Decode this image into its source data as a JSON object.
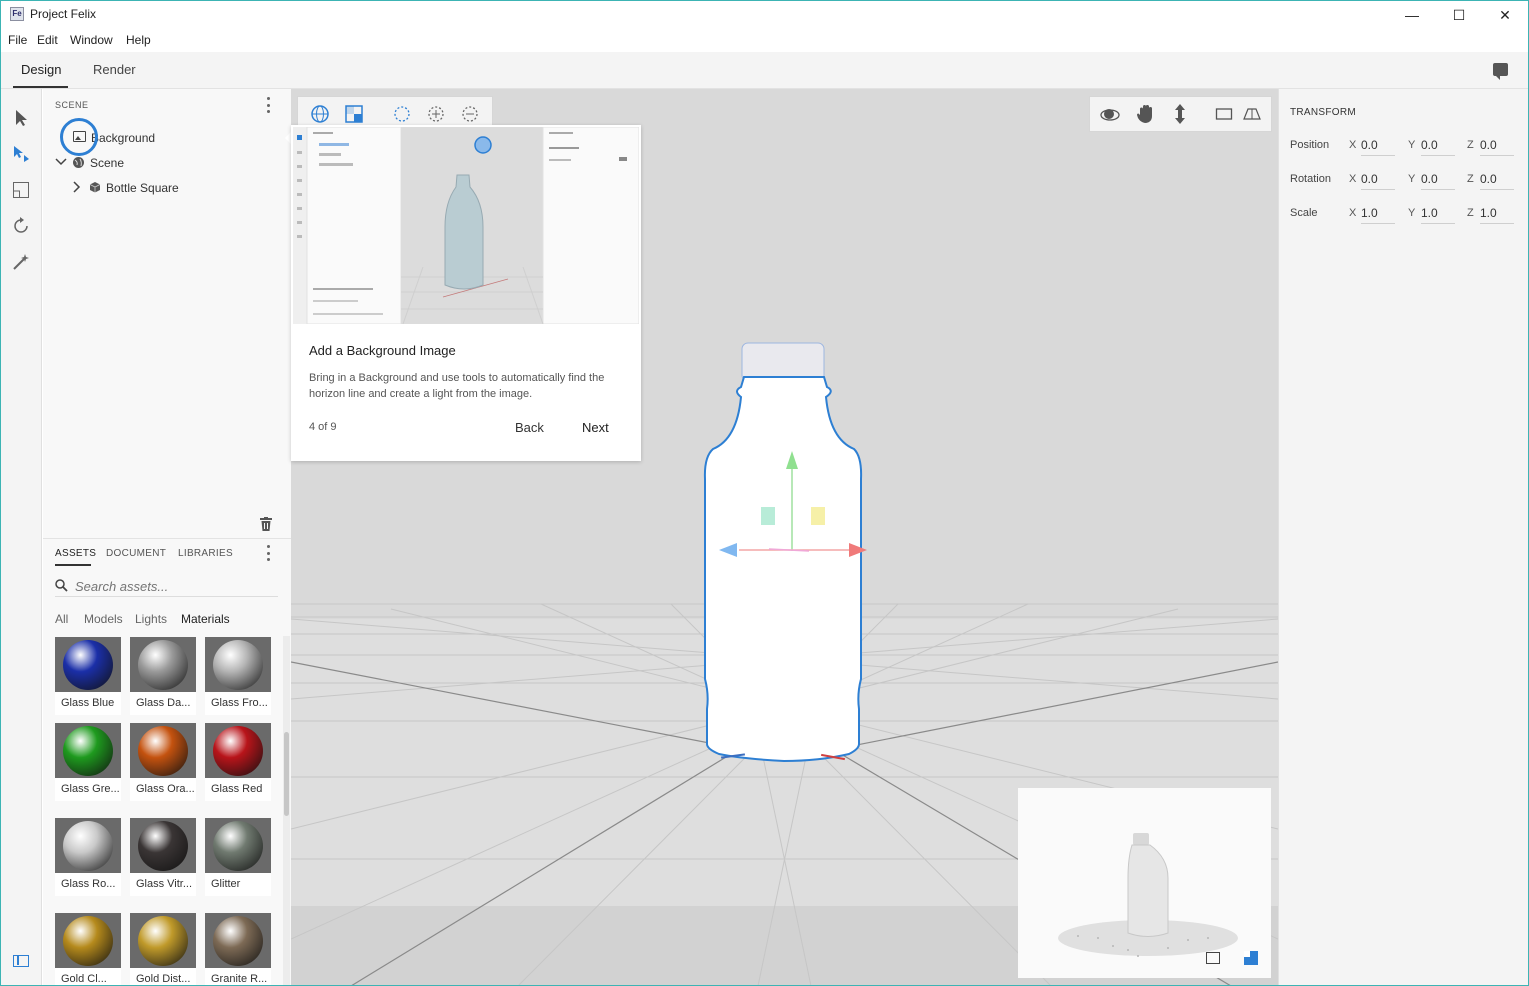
{
  "window": {
    "title": "Project Felix",
    "app_icon_text": "Fe",
    "minimize": "—",
    "maximize": "☐",
    "close": "✕"
  },
  "menu": [
    "File",
    "Edit",
    "Window",
    "Help"
  ],
  "modes": {
    "design": "Design",
    "render": "Render",
    "active": "Design"
  },
  "scene": {
    "header": "SCENE",
    "items": [
      {
        "label": "Background",
        "icon": "image-icon",
        "indent": 0
      },
      {
        "label": "Scene",
        "icon": "globe-icon",
        "indent": 0,
        "expanded": true
      },
      {
        "label": "Bottle Square",
        "icon": "cube-icon",
        "indent": 1,
        "expanded": false
      }
    ]
  },
  "assets": {
    "tabs": [
      "ASSETS",
      "DOCUMENT",
      "LIBRARIES"
    ],
    "active_tab": "ASSETS",
    "search_placeholder": "Search assets...",
    "filters": [
      "All",
      "Models",
      "Lights",
      "Materials"
    ],
    "active_filter": "Materials",
    "tiles": [
      {
        "label": "Glass Blue",
        "color": "#1b2fa8"
      },
      {
        "label": "Glass Da...",
        "color": "#9a9a9a"
      },
      {
        "label": "Glass Fro...",
        "color": "#b5b5b5"
      },
      {
        "label": "Glass Gre...",
        "color": "#1e9a1e"
      },
      {
        "label": "Glass Ora...",
        "color": "#c4520f"
      },
      {
        "label": "Glass Red",
        "color": "#b8141a"
      },
      {
        "label": "Glass Ro...",
        "color": "#c9c9c9"
      },
      {
        "label": "Glass Vitr...",
        "color": "#3a3535"
      },
      {
        "label": "Glitter",
        "color": "#707a70"
      },
      {
        "label": "Gold Cl...",
        "color": "#b58a1c"
      },
      {
        "label": "Gold Dist...",
        "color": "#c09a2a"
      },
      {
        "label": "Granite R...",
        "color": "#7d6a55"
      }
    ]
  },
  "tour": {
    "title": "Add a Background Image",
    "body": "Bring in a Background and use tools to automatically find the horizon line and create a light from the image.",
    "step": "4 of 9",
    "back": "Back",
    "next": "Next"
  },
  "transform": {
    "header": "TRANSFORM",
    "rows": [
      {
        "label": "Position",
        "x": "0.0",
        "y": "0.0",
        "z": "0.0"
      },
      {
        "label": "Rotation",
        "x": "0.0",
        "y": "0.0",
        "z": "0.0"
      },
      {
        "label": "Scale",
        "x": "1.0",
        "y": "1.0",
        "z": "1.0"
      }
    ],
    "axes": [
      "X",
      "Y",
      "Z"
    ]
  },
  "colors": {
    "accent": "#2d7fd3",
    "window_border": "#3cb4b4",
    "gizmo_x": "#f08080",
    "gizmo_y": "#90e090",
    "gizmo_z": "#80b8f0"
  }
}
